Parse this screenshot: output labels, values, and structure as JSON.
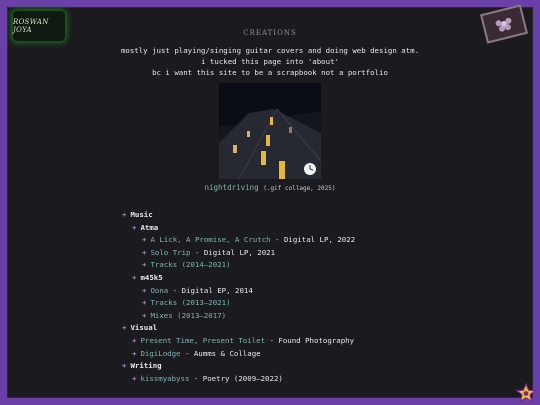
{
  "header": {
    "logo_text": "ROSWAN JOYA",
    "title": "CREATIONS"
  },
  "intro": {
    "lines": [
      "mostly just playing/singing guitar covers and doing web design atm.",
      "i tucked this page into 'about'",
      "bc i want this site to be a scrapbook not a portfolio"
    ]
  },
  "featured": {
    "link": "nightdriving",
    "note": "(.gif collage, 2025)"
  },
  "tree": {
    "bullet": "+",
    "music": {
      "label": "Music",
      "atma": {
        "label": "Atma",
        "items": [
          {
            "link": "A Lick, A Promise, A Crutch",
            "detail": "Digital LP, 2022"
          },
          {
            "link": "Solo Trip",
            "detail": "Digital LP, 2021"
          },
          {
            "link": "Tracks (2014–2021)",
            "detail": ""
          }
        ]
      },
      "m45k5": {
        "label": "m45k5",
        "items": [
          {
            "link": "Oona",
            "detail": "Digital EP, 2014"
          },
          {
            "link": "Tracks (2013–2021)",
            "detail": ""
          },
          {
            "link": "Mixes (2013–2017)",
            "detail": ""
          }
        ]
      }
    },
    "visual": {
      "label": "Visual",
      "items": [
        {
          "link": "Present Time, Present Toilet",
          "detail": "Found Photography"
        },
        {
          "link": "DigiLodge",
          "detail": "Aumms & Collage"
        }
      ]
    },
    "writing": {
      "label": "Writing",
      "items": [
        {
          "link": "kissmyabyss",
          "detail": "Poetry (2009–2022)"
        }
      ]
    },
    "separator": " - "
  },
  "colors": {
    "page_bg": "#6a3fa8",
    "panel_bg": "#1b1b1f",
    "link": "#7fb3b0",
    "bullet": "#c8a8e8"
  }
}
